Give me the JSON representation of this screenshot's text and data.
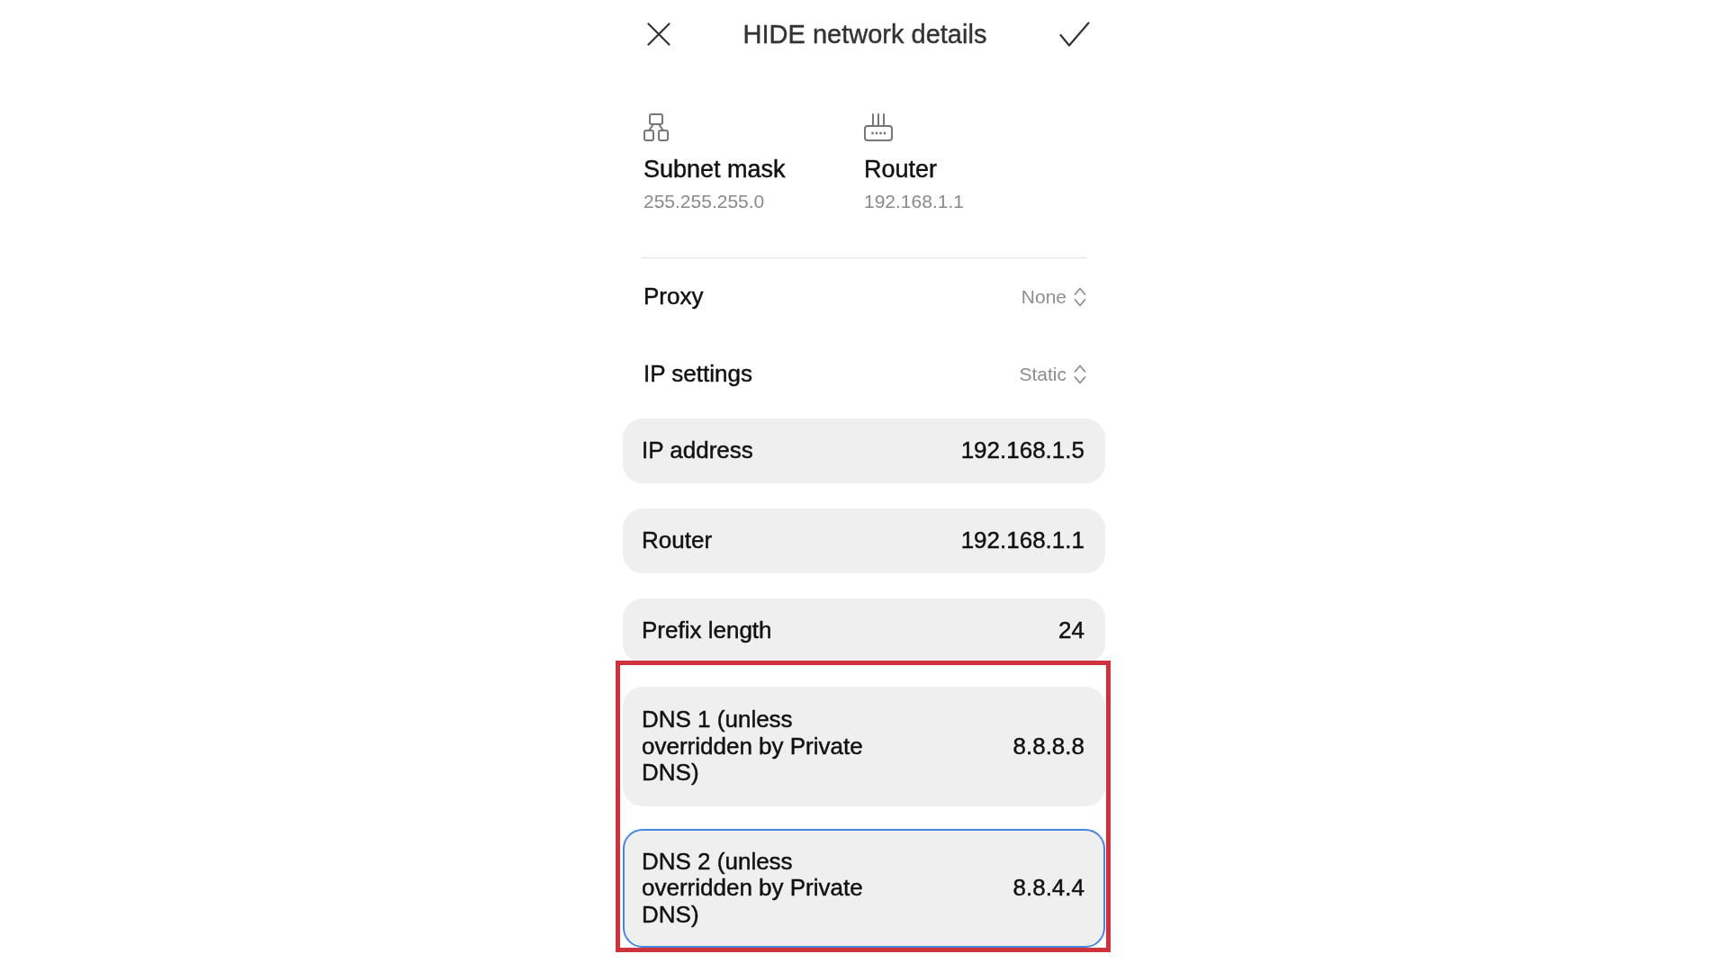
{
  "header": {
    "title": "HIDE network details"
  },
  "summary": {
    "subnet_mask": {
      "label": "Subnet mask",
      "value": "255.255.255.0"
    },
    "router": {
      "label": "Router",
      "value": "192.168.1.1"
    }
  },
  "selectors": [
    {
      "label": "Proxy",
      "value": "None"
    },
    {
      "label": "IP settings",
      "value": "Static"
    }
  ],
  "fields": [
    {
      "label": "IP address",
      "value": "192.168.1.5",
      "focused": false
    },
    {
      "label": "Router",
      "value": "192.168.1.1",
      "focused": false
    },
    {
      "label": "Prefix length",
      "value": "24",
      "focused": false
    }
  ],
  "dns_fields": {
    "highlighted": true,
    "items": [
      {
        "label": "DNS 1 (unless overridden by Private DNS)",
        "value": "8.8.8.8",
        "focused": false
      },
      {
        "label": "DNS 2 (unless overridden by Private DNS)",
        "value": "8.8.4.4",
        "focused": true
      }
    ]
  }
}
